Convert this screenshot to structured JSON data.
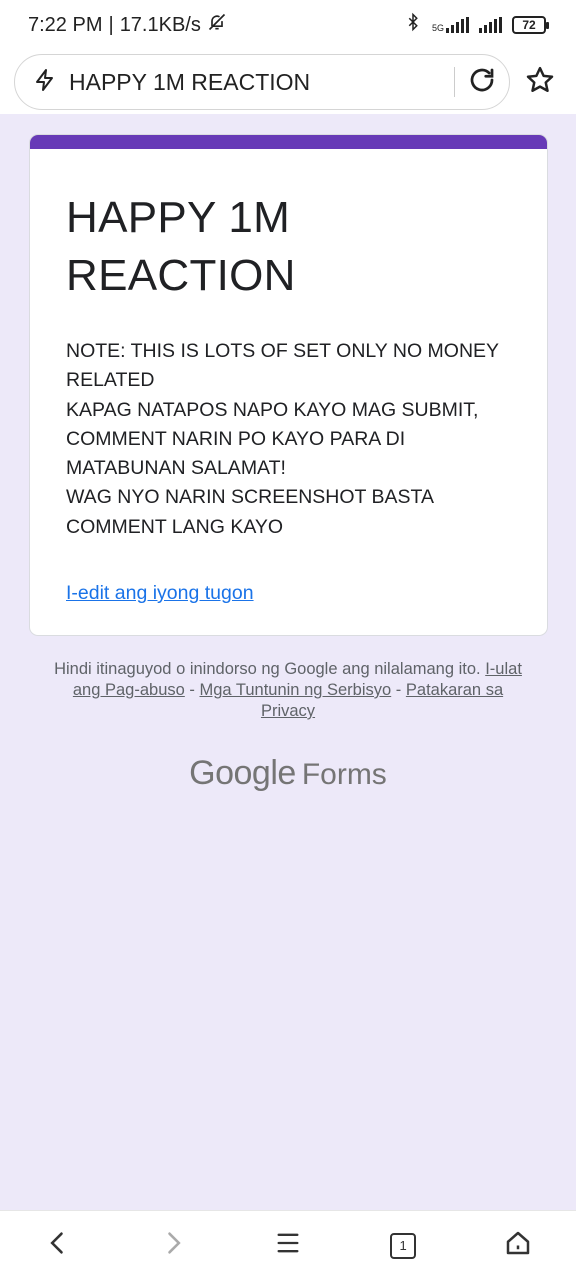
{
  "status_bar": {
    "time": "7:22 PM",
    "speed": "17.1KB/s",
    "separator": "|",
    "network_type": "5G",
    "battery": "72"
  },
  "address_bar": {
    "title": "HAPPY 1M REACTION"
  },
  "form": {
    "title": "HAPPY 1M REACTION",
    "description": "NOTE: THIS IS LOTS OF SET ONLY NO MONEY RELATED\nKAPAG NATAPOS NAPO KAYO MAG SUBMIT, COMMENT NARIN PO KAYO PARA DI MATABUNAN SALAMAT!\nWAG NYO NARIN SCREENSHOT BASTA COMMENT LANG KAYO",
    "edit_link": "I-edit ang iyong tugon",
    "accent_color": "#673ab7"
  },
  "footer": {
    "disclaimer": "Hindi itinaguyod o inindorso ng Google ang nilalamang ito.",
    "report_link": "I-ulat ang Pag-abuso",
    "terms_link": "Mga Tuntunin ng Serbisyo",
    "privacy_link": "Patakaran sa Privacy",
    "dash": "-",
    "brand_google": "Google",
    "brand_forms": "Forms"
  },
  "bottom_nav": {
    "tab_count": "1"
  }
}
